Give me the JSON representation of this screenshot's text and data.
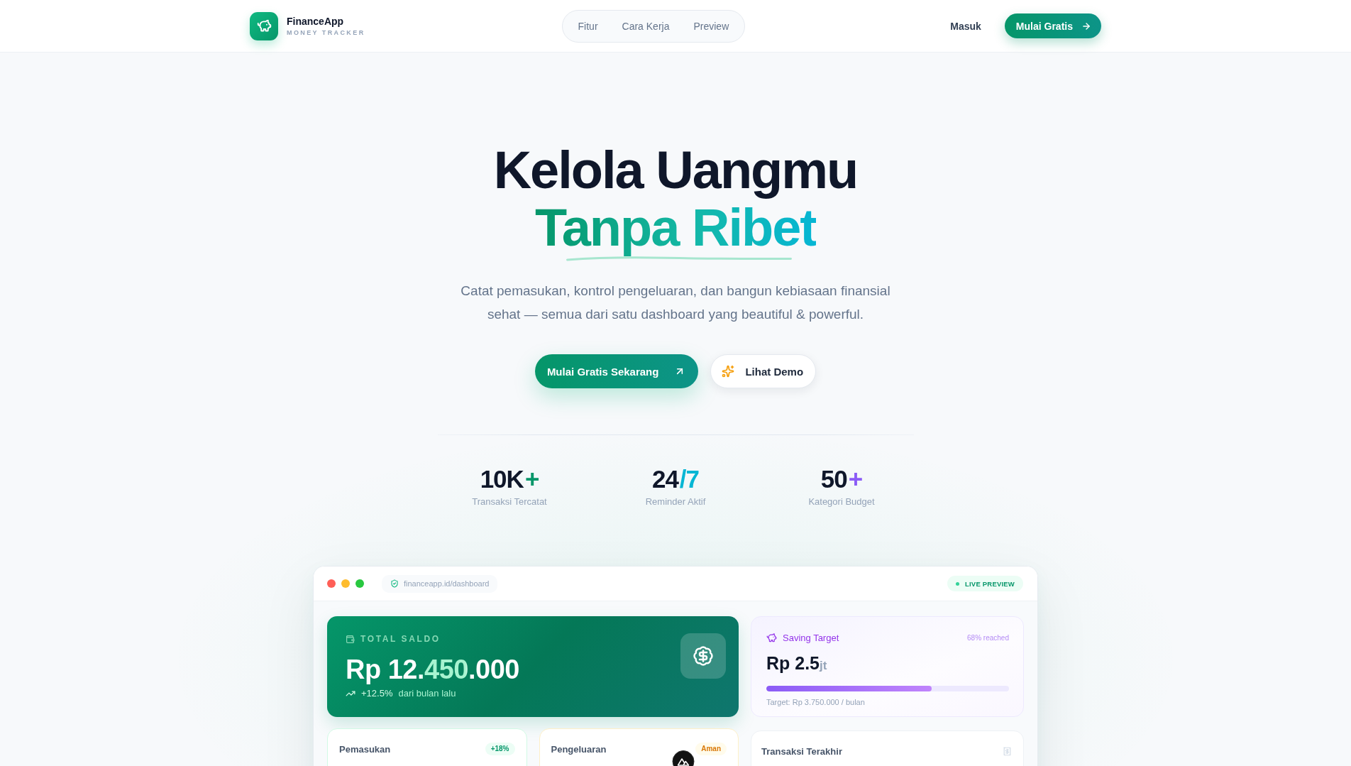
{
  "header": {
    "brand_name": "FinanceApp",
    "brand_tagline": "MONEY TRACKER",
    "nav": [
      "Fitur",
      "Cara Kerja",
      "Preview"
    ],
    "login": "Masuk",
    "cta": "Mulai Gratis"
  },
  "hero": {
    "title": "Kelola Uangmu",
    "title_highlight": "Tanpa Ribet",
    "subtitle": "Catat pemasukan, kontrol pengeluaran, dan bangun kebiasaan finansial sehat — semua dari satu dashboard yang beautiful & powerful.",
    "buttons": [
      {
        "kind": "primary",
        "label": "Mulai Gratis Sekarang"
      },
      {
        "kind": "secondary",
        "label": "Lihat Demo"
      }
    ]
  },
  "stats": [
    {
      "value": "10K",
      "suffix": "+",
      "color": "#059669",
      "label": "Transaksi Tercatat"
    },
    {
      "value": "24",
      "suffix": "/7",
      "color": "#06b6d4",
      "label": "Reminder Aktif"
    },
    {
      "value": "50",
      "suffix": "+",
      "color": "#8b5cf6",
      "label": "Kategori Budget"
    }
  ],
  "preview": {
    "url": "financeapp.id/dashboard",
    "badge": "LIVE PREVIEW",
    "balance": {
      "label": "TOTAL SALDO",
      "amount": "Rp 12.450.000",
      "change": "+12.5%",
      "note": "dari bulan lalu"
    },
    "saving": {
      "title": "Saving Target",
      "progress_note": "68% reached",
      "amount": "Rp 2.5",
      "unit": "jt",
      "level": 0.68,
      "target": "Target: Rp 3.750.000 / bulan"
    },
    "summary_cards": [
      {
        "kind": "income",
        "title": "Pemasukan",
        "tag": "+18%"
      },
      {
        "kind": "expense",
        "title": "Pengeluaran",
        "tag": "Aman"
      }
    ],
    "recent": {
      "title": "Transaksi Terakhir"
    }
  }
}
